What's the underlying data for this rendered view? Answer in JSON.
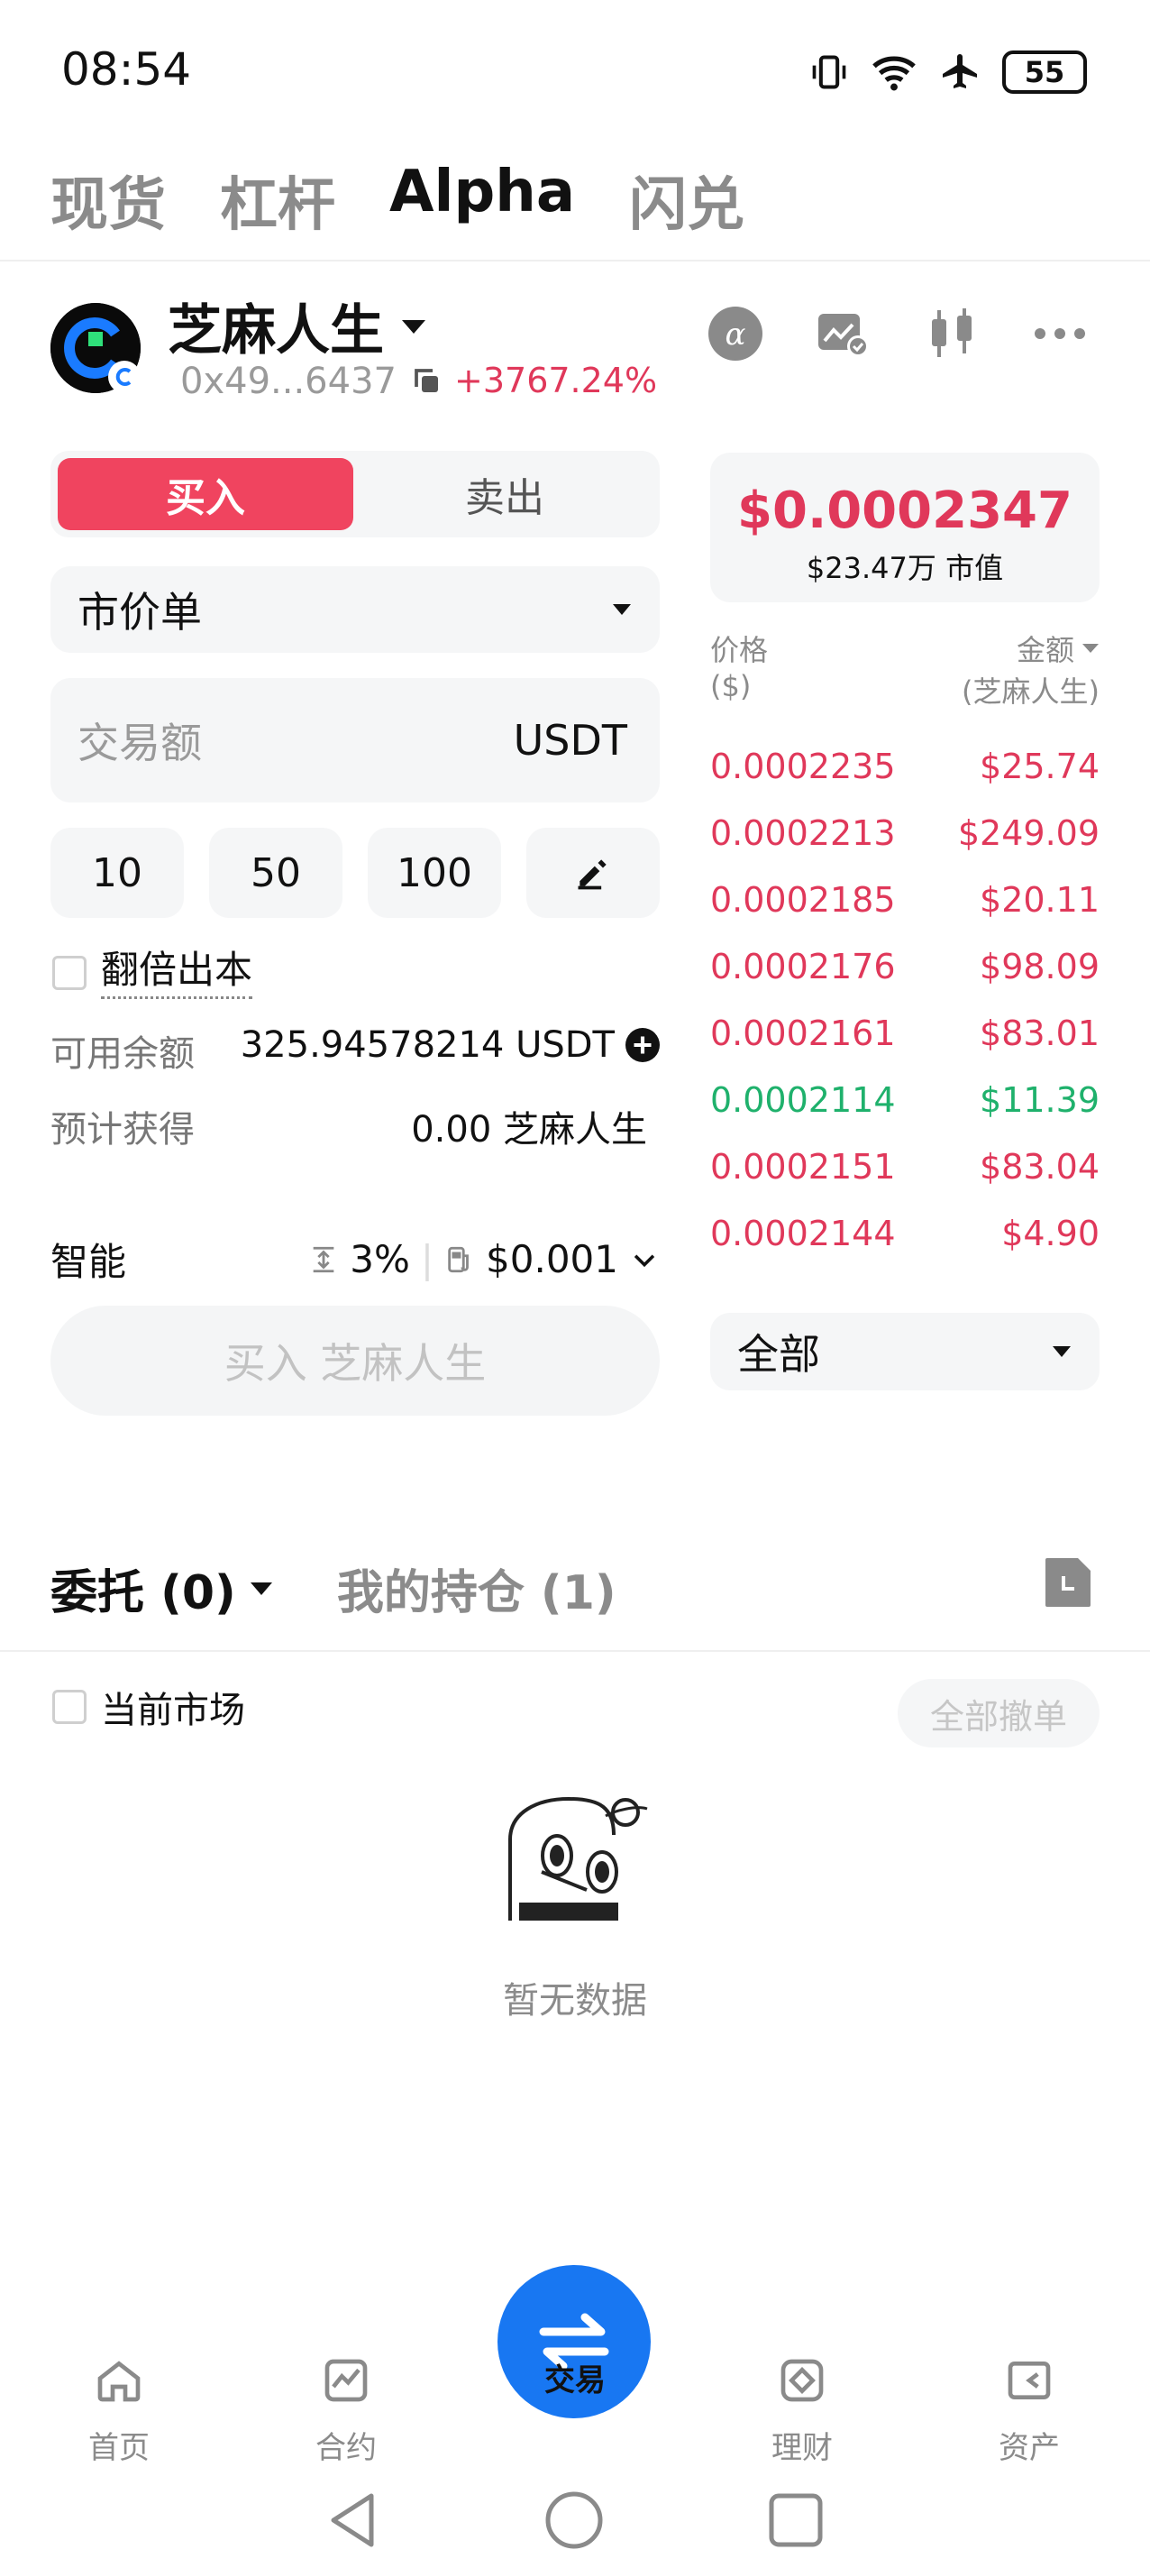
{
  "status_bar": {
    "time": "08:54",
    "battery": "55",
    "icons": [
      "vibrate-icon",
      "wifi-icon",
      "airplane-icon",
      "battery-icon"
    ]
  },
  "top_tabs": [
    "现货",
    "杠杆",
    "Alpha",
    "闪兑"
  ],
  "active_tab": "Alpha",
  "token": {
    "name": "芝麻人生",
    "address": "0x49...6437",
    "change": "+3767.24%"
  },
  "trade": {
    "buy_label": "买入",
    "sell_label": "卖出",
    "order_type": "市价单",
    "amount_placeholder": "交易额",
    "amount_unit": "USDT",
    "quick_amounts": [
      "10",
      "50",
      "100"
    ],
    "double_principal": "翻倍出本",
    "available_label": "可用余额",
    "available_value": "325.94578214 USDT",
    "estimate_label": "预计获得",
    "estimate_value": "0.00 芝麻人生",
    "smart_label": "智能",
    "slippage": "3%",
    "gas": "$0.001",
    "cta": "买入 芝麻人生"
  },
  "price_card": {
    "price": "$0.0002347",
    "market_cap": "$23.47万 市值"
  },
  "orderbook": {
    "col_price": "价格",
    "col_price_unit": "($)",
    "col_amount": "金额",
    "col_amount_unit": "(芝麻人生)",
    "rows": [
      {
        "price": "0.0002235",
        "amount": "$25.74",
        "side": "sell"
      },
      {
        "price": "0.0002213",
        "amount": "$249.09",
        "side": "sell"
      },
      {
        "price": "0.0002185",
        "amount": "$20.11",
        "side": "sell"
      },
      {
        "price": "0.0002176",
        "amount": "$98.09",
        "side": "sell"
      },
      {
        "price": "0.0002161",
        "amount": "$83.01",
        "side": "sell"
      },
      {
        "price": "0.0002114",
        "amount": "$11.39",
        "side": "buy"
      },
      {
        "price": "0.0002151",
        "amount": "$83.04",
        "side": "sell"
      },
      {
        "price": "0.0002144",
        "amount": "$4.90",
        "side": "sell"
      }
    ],
    "filter": "全部"
  },
  "orders": {
    "tab_orders": "委托 (0)",
    "tab_positions": "我的持仓 (1)",
    "current_market": "当前市场",
    "cancel_all": "全部撤单",
    "empty": "暂无数据"
  },
  "bottom_nav": [
    "首页",
    "合约",
    "交易",
    "理财",
    "资产"
  ],
  "colors": {
    "red": "#e0385a",
    "green": "#1fb16c",
    "accent": "#1877f2"
  }
}
